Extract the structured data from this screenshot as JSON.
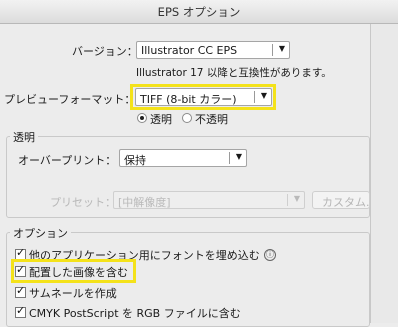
{
  "window": {
    "title": "EPS オプション"
  },
  "version": {
    "label": "バージョン：",
    "value": "Illustrator CC EPS",
    "note": "Illustrator 17 以降と互換性があります。"
  },
  "preview": {
    "label": "プレビューフォーマット：",
    "value": "TIFF (8-bit カラー)",
    "radio_transparent": "透明",
    "radio_opaque": "不透明",
    "selected": "透明"
  },
  "transparency": {
    "group_title": "透明",
    "overprint_label": "オーバープリント：",
    "overprint_value": "保持",
    "preset_label": "プリセット：",
    "preset_value": "[中解像度]",
    "custom_button": "カスタム..."
  },
  "options": {
    "group_title": "オプション",
    "items": [
      {
        "label": "他のアプリケーション用にフォントを埋め込む",
        "checked": true
      },
      {
        "label": "配置した画像を含む",
        "checked": true
      },
      {
        "label": "サムネールを作成",
        "checked": true
      },
      {
        "label": "CMYK PostScript を RGB ファイルに含む",
        "checked": true
      }
    ],
    "info_icon": "ⓘ"
  },
  "colors": {
    "highlight": "#f4e21a",
    "background": "#ececec"
  }
}
